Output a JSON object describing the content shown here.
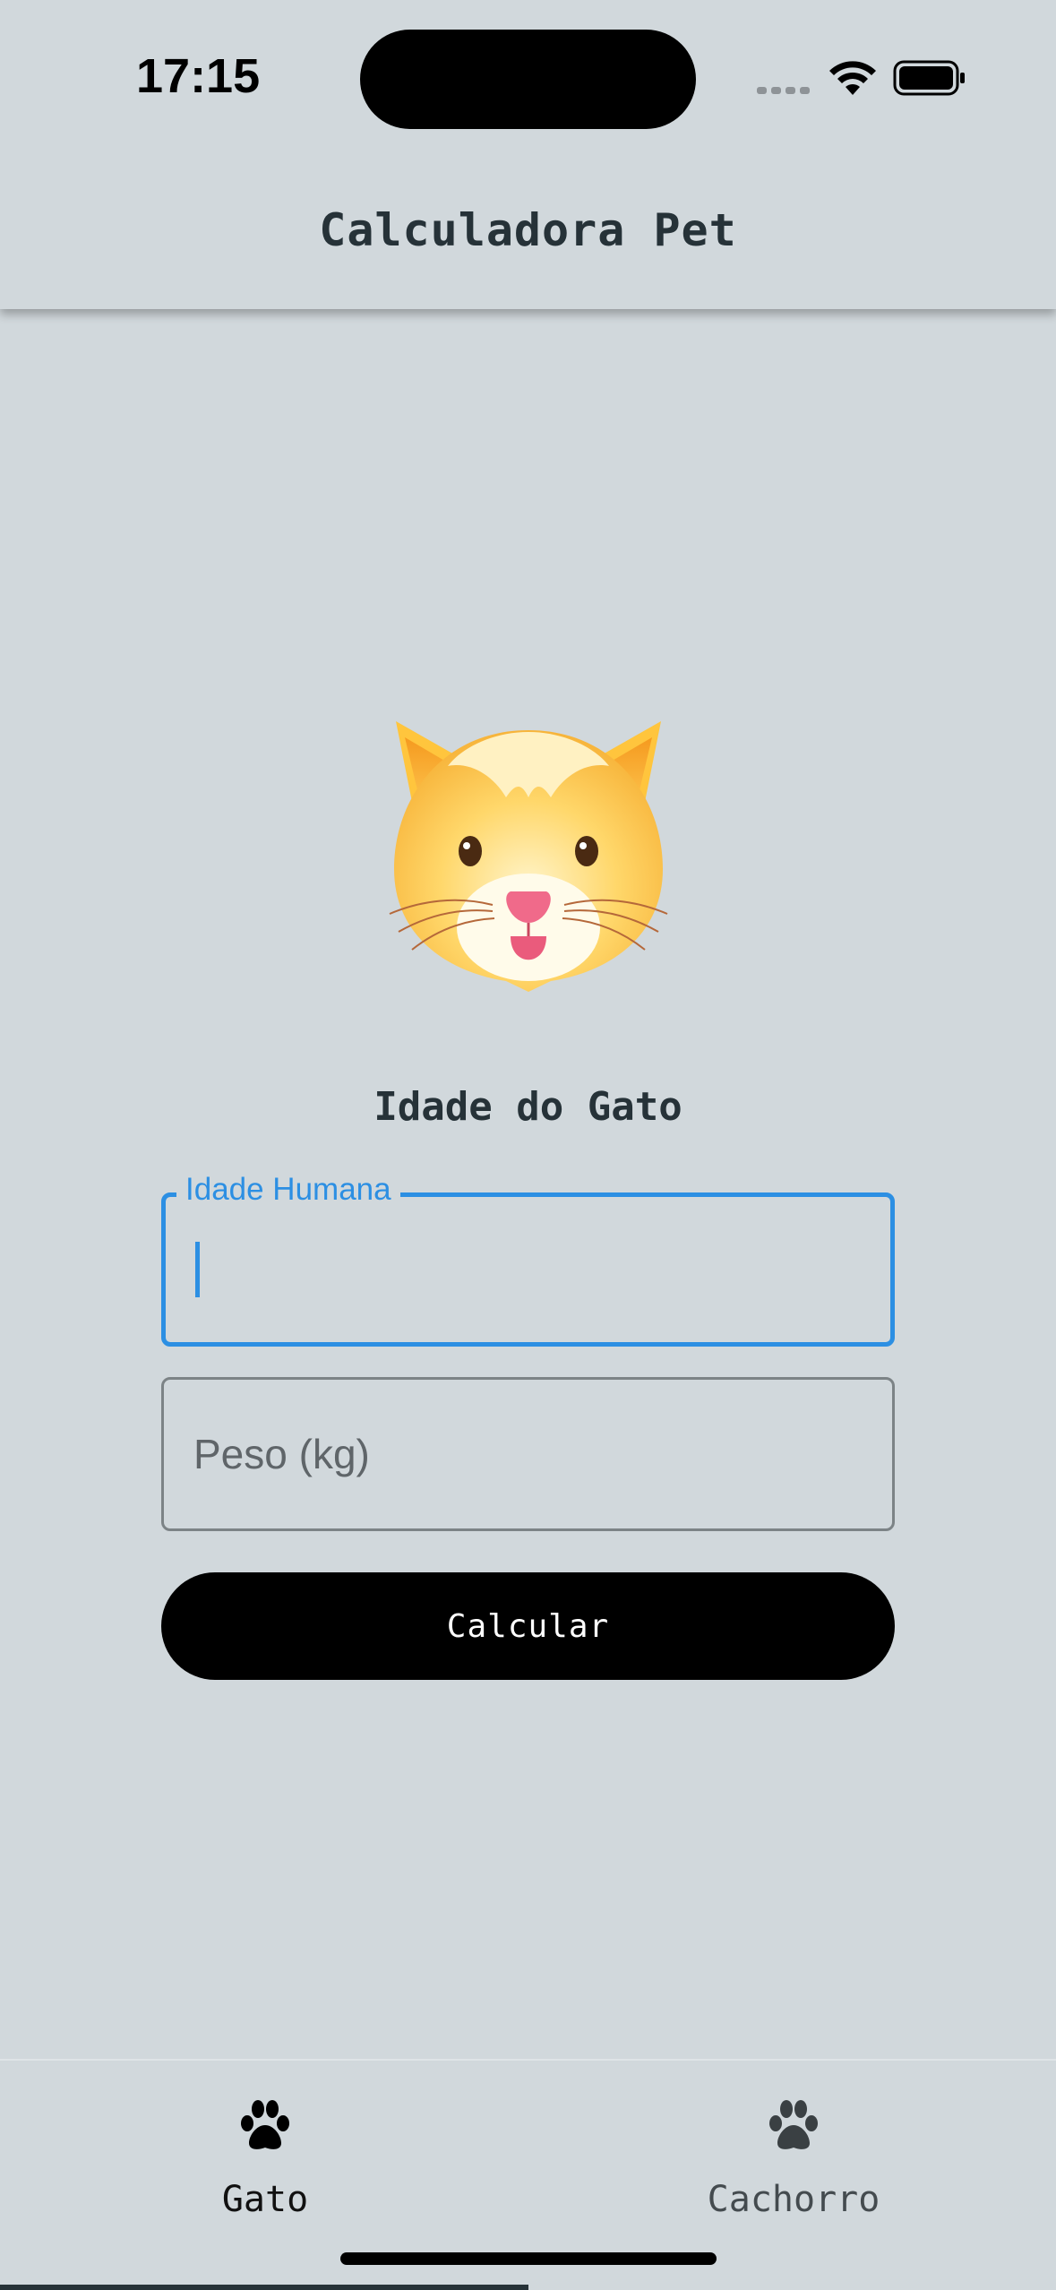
{
  "status_bar": {
    "time": "17:15",
    "icons": [
      "signal-dots-icon",
      "wifi-icon",
      "battery-icon"
    ]
  },
  "app_bar": {
    "title": "Calculadora Pet"
  },
  "main": {
    "image": "cat-face-emoji",
    "section_title": "Idade do Gato",
    "age_field": {
      "label": "Idade Humana",
      "value": ""
    },
    "weight_field": {
      "placeholder": "Peso (kg)",
      "value": ""
    },
    "calculate_button": "Calcular"
  },
  "bottom_nav": {
    "tabs": [
      {
        "label": "Gato",
        "icon": "paw-icon",
        "selected": true
      },
      {
        "label": "Cachorro",
        "icon": "paw-icon",
        "selected": false
      }
    ]
  },
  "colors": {
    "background": "#d1d8dc",
    "accent": "#2c8fe3",
    "text": "#263238",
    "button": "#000000"
  }
}
